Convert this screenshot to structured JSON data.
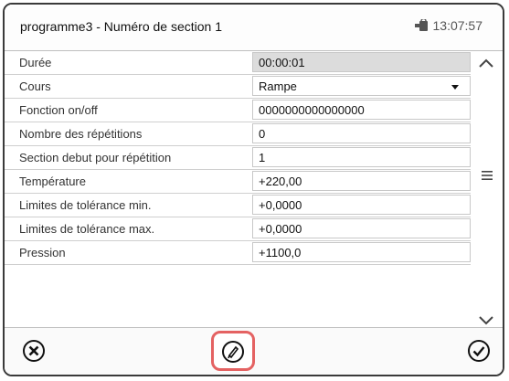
{
  "header": {
    "title": "programme3 - Numéro de section 1",
    "time": "13:07:57",
    "lock_icon": "lock-icon"
  },
  "rows": [
    {
      "label": "Durée",
      "value": "00:00:01"
    },
    {
      "label": "Cours",
      "value": "Rampe"
    },
    {
      "label": "Fonction on/off",
      "value": "0000000000000000"
    },
    {
      "label": "Nombre des répétitions",
      "value": "0"
    },
    {
      "label": "Section debut pour répétition",
      "value": "1"
    },
    {
      "label": "Température",
      "value": "+220,00"
    },
    {
      "label": "Limites de tolérance min.",
      "value": "+0,0000"
    },
    {
      "label": "Limites de tolérance max.",
      "value": "+0,0000"
    },
    {
      "label": "Pression",
      "value": "+1100,0"
    }
  ],
  "colors": {
    "highlight": "#e46262",
    "disabled_field": "#dcdcdc"
  }
}
